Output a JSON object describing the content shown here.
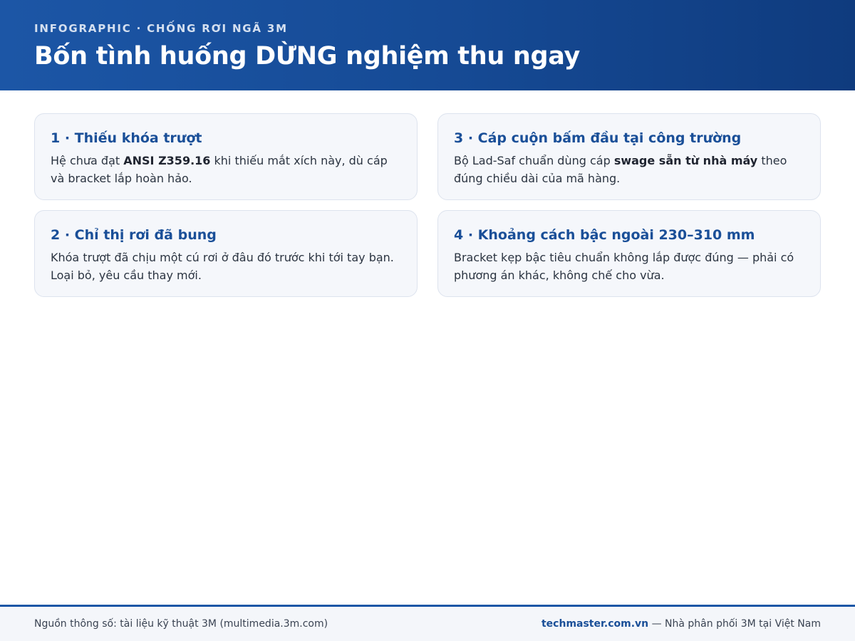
{
  "header": {
    "kicker": "INFOGRAPHIC · CHỐNG RƠI NGÃ 3M",
    "title": "Bốn tình huống DỪNG nghiệm thu ngay"
  },
  "cards": [
    {
      "title": "1 · Thiếu khóa trượt",
      "body_before": "Hệ chưa đạt ",
      "body_bold": "ANSI Z359.16",
      "body_after": " khi thiếu mắt xích này, dù cáp và bracket lắp hoàn hảo."
    },
    {
      "title": "2 · Chỉ thị rơi đã bung",
      "body": "Khóa trượt đã chịu một cú rơi ở đâu đó trước khi tới tay bạn. Loại bỏ, yêu cầu thay mới."
    },
    {
      "title": "3 · Cáp cuộn bấm đầu tại công trường",
      "body_before": "Bộ Lad-Saf chuẩn dùng cáp ",
      "body_bold": "swage sẵn từ nhà máy",
      "body_after": " theo đúng chiều dài của mã hàng."
    },
    {
      "title": "4 · Khoảng cách bậc ngoài 230–310 mm",
      "body": "Bracket kẹp bậc tiêu chuẩn không lắp được đúng — phải có phương án khác, không chế cho vừa."
    }
  ],
  "footer": {
    "source": "Nguồn thông số: tài liệu kỹ thuật 3M (multimedia.3m.com)",
    "brand": "techmaster.com.vn",
    "brand_suffix": " — Nhà phân phối 3M tại Việt Nam"
  },
  "colors": {
    "header_start": "#1c56a6",
    "header_end": "#0f3b7e",
    "accent": "#1a4f98",
    "card_bg": "#f5f7fb"
  }
}
